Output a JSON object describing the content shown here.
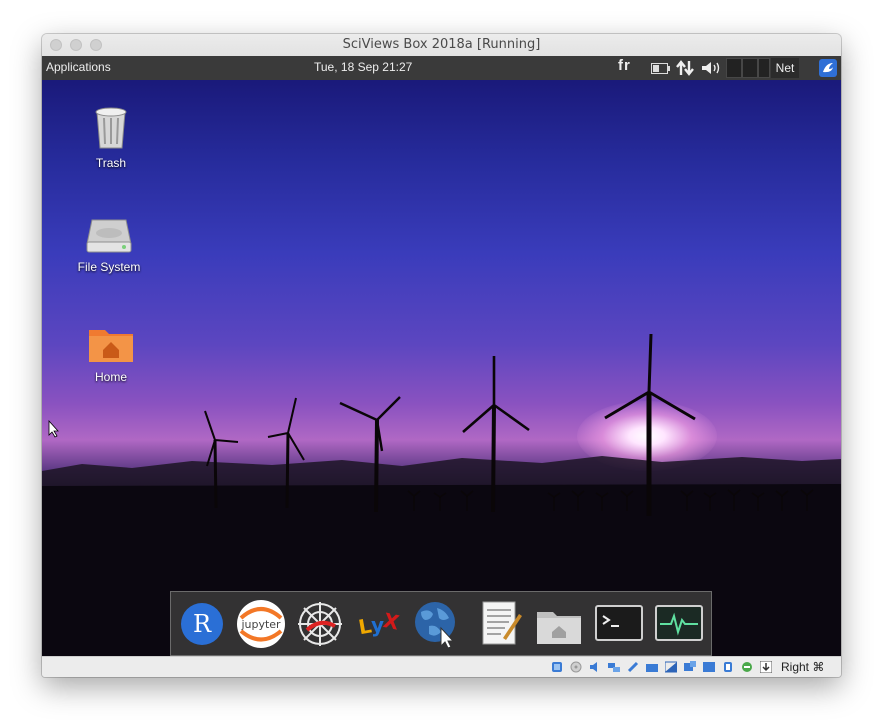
{
  "window": {
    "title": "SciViews Box 2018a [Running]"
  },
  "topbar": {
    "applications": "Applications",
    "clock": "Tue, 18 Sep  21:27",
    "keyboard_layout": "fr",
    "net_label": "Net"
  },
  "desktop": {
    "icons": [
      {
        "label": "Trash",
        "icon": "trash-icon"
      },
      {
        "label": "File System",
        "icon": "drive-icon"
      },
      {
        "label": "Home",
        "icon": "home-folder-icon"
      }
    ]
  },
  "dock": {
    "items": [
      {
        "name": "R",
        "label": "R",
        "icon": "r-icon",
        "color": "#2a6fd6"
      },
      {
        "name": "Jupyter",
        "label": "jupyter",
        "icon": "jupyter-icon",
        "color": "#f37726"
      },
      {
        "name": "Zotero / web",
        "icon": "web-spider-icon"
      },
      {
        "name": "LyX",
        "label": "LyX",
        "icon": "lyx-icon"
      },
      {
        "name": "Web browser",
        "icon": "globe-icon"
      },
      {
        "name": "Text editor",
        "icon": "text-editor-icon"
      },
      {
        "name": "File manager",
        "icon": "folder-home-icon"
      },
      {
        "name": "Terminal",
        "icon": "terminal-icon"
      },
      {
        "name": "System monitor",
        "icon": "system-monitor-icon"
      }
    ]
  },
  "statusbar": {
    "host_key": "Right ⌘"
  },
  "colors": {
    "topbar": "#3a3a3a",
    "r_blue": "#2a6fd6",
    "jupyter_orange": "#f37726",
    "home_orange": "#f0742a"
  }
}
